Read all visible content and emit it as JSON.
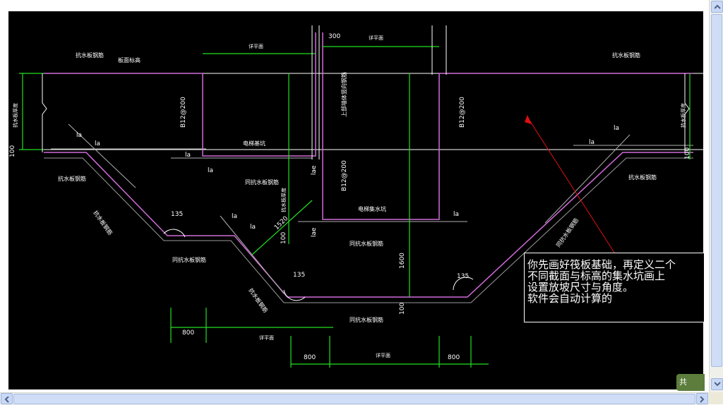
{
  "drawing": {
    "labels": {
      "kang_shui_ban_gang_jin": "抗水板钢筋",
      "ban_mian_biao_gao": "板面标高",
      "xiang_ping_mian": "详平面",
      "dian_ti_ji_keng": "电梯基坑",
      "dian_ti_ji_shui_keng": "电梯集水坑",
      "tong_kang_shui_ban_gang_jin": "同抗水板钢筋",
      "kang_shui_ban_hou_du": "抗水板厚度",
      "shang_zhe_dian_ti_ji_keng": "上部墙体竖向钢筋",
      "rebar_b12_left": "B12@200",
      "rebar_b12_right": "B12@200",
      "rebar_b12_mid": "B12@200",
      "la": "la",
      "lae": "lae",
      "angle_135": "135",
      "dim_300": "300",
      "dim_100": "100",
      "dim_1520": "1520",
      "dim_1600": "1600",
      "dim_800": "800"
    }
  },
  "callout": {
    "lines": [
      "你先画好筏板基础，再定义二个",
      "不同截面与标高的集水坑画上",
      "设置放坡尺寸与角度。",
      "软件会自动计算的"
    ]
  },
  "badge": {
    "label": "共"
  }
}
